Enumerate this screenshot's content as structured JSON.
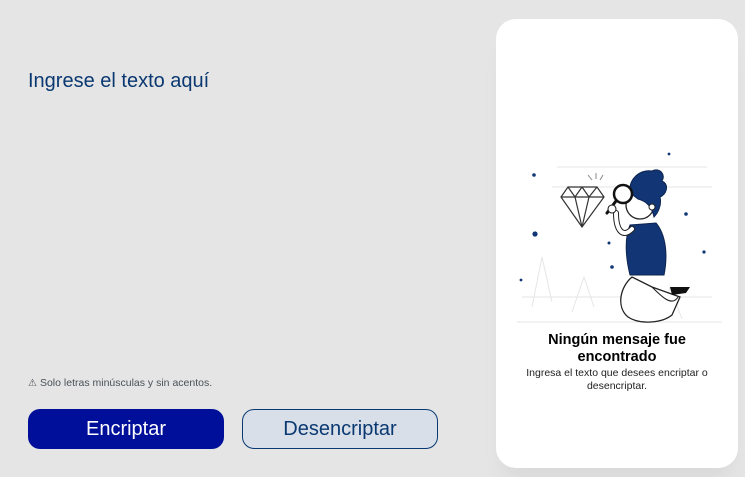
{
  "input": {
    "placeholder": "Ingrese el texto aquí",
    "value": ""
  },
  "hint": {
    "icon": "warning-icon",
    "text": "Solo letras minúsculas y sin acentos."
  },
  "buttons": {
    "encrypt_label": "Encriptar",
    "decrypt_label": "Desencriptar"
  },
  "output": {
    "illustration": "person-with-magnifying-glass-and-diamond",
    "title": "Ningún mensaje fue encontrado",
    "subtitle": "Ingresa el texto que desees encriptar o desencriptar."
  },
  "colors": {
    "background": "#e5e5e5",
    "primary": "#000f99",
    "text_accent": "#0a3871",
    "secondary_button": "#d8dfe8",
    "panel": "#ffffff"
  }
}
